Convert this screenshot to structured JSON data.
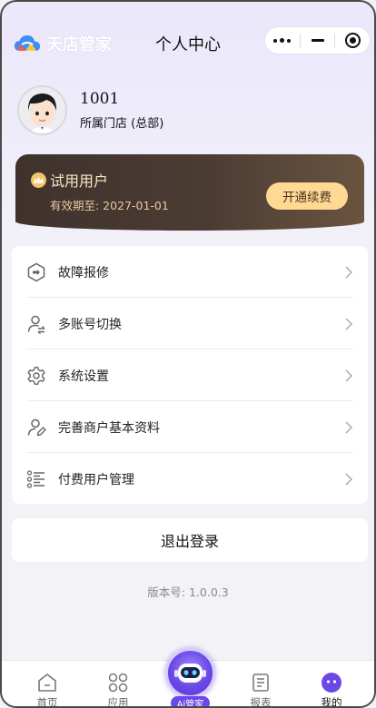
{
  "header": {
    "app_name": "天店管家",
    "title": "个人中心",
    "capsule_icons": [
      "more-dots-icon",
      "minimize-icon",
      "close-target-icon"
    ]
  },
  "profile": {
    "user_name": "1001",
    "store": "所属门店 (总部)",
    "avatar_icon": "cartoon-avatar-icon"
  },
  "vip": {
    "title": "试用用户",
    "expire": "有效期至: 2027-01-01",
    "renew_label": "开通续费",
    "colors": {
      "card": "#4b3c33",
      "button": "#ffd993"
    }
  },
  "menu": {
    "items": [
      {
        "label": "故障报修",
        "icon": "repair-icon"
      },
      {
        "label": "多账号切换",
        "icon": "switch-account-icon"
      },
      {
        "label": "系统设置",
        "icon": "settings-icon"
      },
      {
        "label": "完善商户基本资料",
        "icon": "edit-profile-icon"
      },
      {
        "label": "付费用户管理",
        "icon": "list-icon"
      }
    ]
  },
  "logout_label": "退出登录",
  "version": "版本号:  1.0.0.3",
  "tabbar": {
    "tabs": [
      {
        "label": "首页",
        "icon": "home-icon"
      },
      {
        "label": "应用",
        "icon": "apps-icon"
      },
      {
        "label": "报表",
        "icon": "report-icon"
      },
      {
        "label": "我的",
        "icon": "mine-icon"
      }
    ],
    "ai_label": "Ai管家",
    "active_color": "#6a48e6"
  }
}
